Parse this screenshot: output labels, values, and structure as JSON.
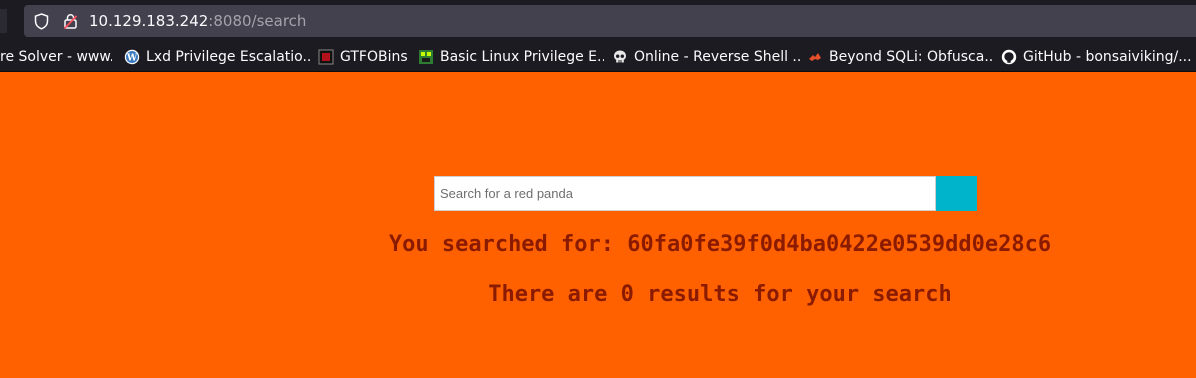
{
  "browser": {
    "url_host": "10.129.183.242",
    "url_rest": ":8080/search",
    "bookmarks": [
      {
        "label": "re Solver - www...",
        "icon": "page-icon"
      },
      {
        "label": "Lxd Privilege Escalatio...",
        "icon": "wordpress-icon"
      },
      {
        "label": "GTFOBins",
        "icon": "gtfobins-icon"
      },
      {
        "label": "Basic Linux Privilege E...",
        "icon": "pixel-art-icon"
      },
      {
        "label": "Online - Reverse Shell ...",
        "icon": "skull-icon"
      },
      {
        "label": "Beyond SQLi: Obfusca...",
        "icon": "flame-icon"
      },
      {
        "label": "GitHub - bonsaiviking/...",
        "icon": "github-icon"
      }
    ]
  },
  "page": {
    "search_placeholder": "Search for a red panda",
    "searched_for_label": "You searched for:",
    "searched_for_value": "60fa0fe39f0d4ba0422e0539dd0e28c6",
    "results_text": "There are 0 results for your search"
  },
  "colors": {
    "page_background": "#ff6100",
    "result_text": "#8b1b00",
    "search_button": "#00b4cc",
    "chrome_background": "#1c1b22"
  }
}
